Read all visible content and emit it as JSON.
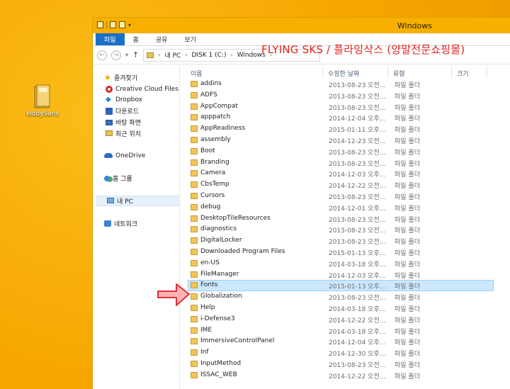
{
  "desktop": {
    "icon_label": "kiddySans"
  },
  "window": {
    "title": "Windows",
    "overlay_caption": "FLYING SKS / 플라잉삭스 (양말전문쇼핑몰)"
  },
  "ribbon": {
    "tabs": [
      "파일",
      "홈",
      "공유",
      "보기"
    ]
  },
  "address": {
    "crumbs": [
      "내 PC",
      "DISK 1 (C:)",
      "Windows"
    ]
  },
  "nav_pane": {
    "favorites": "즐겨찾기",
    "favorites_items": [
      "Creative Cloud Files",
      "Dropbox",
      "다운로드",
      "바탕 화면",
      "최근 위치"
    ],
    "onedrive": "OneDrive",
    "homegroup": "홈 그룹",
    "this_pc": "내 PC",
    "network": "네트워크"
  },
  "columns": {
    "name": "이름",
    "date": "수정한 날짜",
    "type": "유형",
    "size": "크기"
  },
  "files": [
    {
      "name": "addins",
      "date": "2013-08-23 오전...",
      "type": "파일 폴더"
    },
    {
      "name": "ADFS",
      "date": "2013-08-23 오전...",
      "type": "파일 폴더"
    },
    {
      "name": "AppCompat",
      "date": "2013-08-23 오전...",
      "type": "파일 폴더"
    },
    {
      "name": "apppatch",
      "date": "2014-12-04 오후...",
      "type": "파일 폴더"
    },
    {
      "name": "AppReadiness",
      "date": "2015-01-11 오후...",
      "type": "파일 폴더"
    },
    {
      "name": "assembly",
      "date": "2014-12-23 오전...",
      "type": "파일 폴더"
    },
    {
      "name": "Boot",
      "date": "2013-08-23 오전...",
      "type": "파일 폴더"
    },
    {
      "name": "Branding",
      "date": "2013-08-23 오전...",
      "type": "파일 폴더"
    },
    {
      "name": "Camera",
      "date": "2014-12-03 오후...",
      "type": "파일 폴더"
    },
    {
      "name": "CbsTemp",
      "date": "2014-12-22 오전...",
      "type": "파일 폴더"
    },
    {
      "name": "Cursors",
      "date": "2013-08-23 오전...",
      "type": "파일 폴더"
    },
    {
      "name": "debug",
      "date": "2014-12-01 오후...",
      "type": "파일 폴더"
    },
    {
      "name": "DesktopTileResources",
      "date": "2013-08-23 오전...",
      "type": "파일 폴더"
    },
    {
      "name": "diagnostics",
      "date": "2013-08-23 오전...",
      "type": "파일 폴더"
    },
    {
      "name": "DigitalLocker",
      "date": "2013-08-23 오전...",
      "type": "파일 폴더"
    },
    {
      "name": "Downloaded Program Files",
      "date": "2015-01-13 오후...",
      "type": "파일 폴더"
    },
    {
      "name": "en-US",
      "date": "2014-03-18 오후...",
      "type": "파일 폴더"
    },
    {
      "name": "FileManager",
      "date": "2014-12-03 오후...",
      "type": "파일 폴더"
    },
    {
      "name": "Fonts",
      "date": "2015-01-13 오후...",
      "type": "파일 폴더",
      "selected": true
    },
    {
      "name": "Globalization",
      "date": "2013-08-23 오전...",
      "type": "파일 폴더"
    },
    {
      "name": "Help",
      "date": "2014-03-18 오후...",
      "type": "파일 폴더"
    },
    {
      "name": "i-Defense3",
      "date": "2014-12-22 오전...",
      "type": "파일 폴더"
    },
    {
      "name": "IME",
      "date": "2014-03-18 오후...",
      "type": "파일 폴더"
    },
    {
      "name": "ImmersiveControlPanel",
      "date": "2014-12-04 오후...",
      "type": "파일 폴더"
    },
    {
      "name": "Inf",
      "date": "2014-12-30 오후...",
      "type": "파일 폴더"
    },
    {
      "name": "InputMethod",
      "date": "2013-08-23 오전...",
      "type": "파일 폴더"
    },
    {
      "name": "ISSAC_WEB",
      "date": "2014-12-22 오전...",
      "type": "파일 폴더"
    }
  ],
  "colors": {
    "desktop": "#f7a700",
    "titlebar": "#f8b000",
    "file_tab": "#1a6fc7",
    "selection": "#cce8ff",
    "caption": "#e2231f",
    "pointer_arrow": "#e0303a"
  }
}
